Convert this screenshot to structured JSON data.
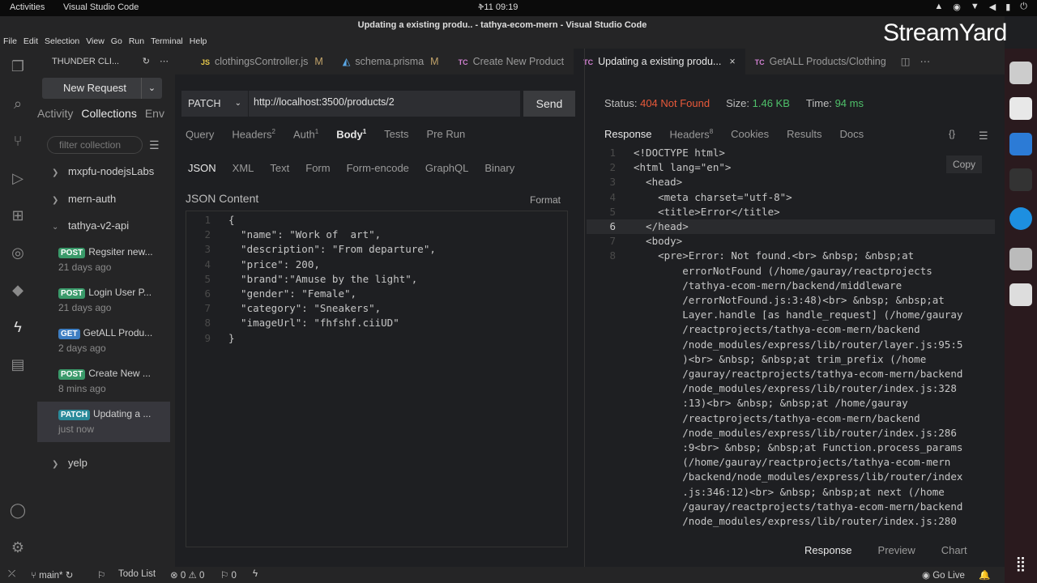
{
  "system": {
    "activities": "Activities",
    "app": "Visual Studio Code",
    "clock": "ቅ11 09:19"
  },
  "window": {
    "title": "Updating a existing produ.. - tathya-ecom-mern - Visual Studio Code"
  },
  "menu": [
    "File",
    "Edit",
    "Selection",
    "View",
    "Go",
    "Run",
    "Terminal",
    "Help"
  ],
  "watermark": "StreamYard",
  "sidebar": {
    "header": "THUNDER CLI...",
    "new_request": "New Request",
    "tabs": [
      "Activity",
      "Collections",
      "Env"
    ],
    "filter_placeholder": "filter collection",
    "folders": [
      {
        "name": "mxpfu-nodejsLabs",
        "expanded": false
      },
      {
        "name": "mern-auth",
        "expanded": false
      },
      {
        "name": "tathya-v2-api",
        "expanded": true
      },
      {
        "name": "yelp",
        "expanded": false
      }
    ],
    "requests": [
      {
        "method": "POST",
        "name": "Regsiter new...",
        "time": "21 days ago"
      },
      {
        "method": "POST",
        "name": "Login User P...",
        "time": "21 days ago"
      },
      {
        "method": "GET",
        "name": "GetALL Produ...",
        "time": "2 days ago"
      },
      {
        "method": "POST",
        "name": "Create New ...",
        "time": "8 mins ago"
      },
      {
        "method": "PATCH",
        "name": "Updating a ...",
        "time": "just now"
      }
    ]
  },
  "tabs": [
    {
      "icon": "JS",
      "label": "clothingsController.js",
      "mod": "M"
    },
    {
      "icon": "prisma",
      "label": "schema.prisma",
      "mod": "M"
    },
    {
      "icon": "TC",
      "label": "Create New Product",
      "mod": ""
    },
    {
      "icon": "TC",
      "label": "Updating a existing produ...",
      "mod": "",
      "close": "×"
    },
    {
      "icon": "TC",
      "label": "GetALL Products/Clothing",
      "mod": ""
    }
  ],
  "request": {
    "method": "PATCH",
    "url": "http://localhost:3500/products/2",
    "send": "Send",
    "tabs": [
      {
        "label": "Query",
        "count": ""
      },
      {
        "label": "Headers",
        "count": "2"
      },
      {
        "label": "Auth",
        "count": "1"
      },
      {
        "label": "Body",
        "count": "1"
      },
      {
        "label": "Tests",
        "count": ""
      },
      {
        "label": "Pre Run",
        "count": ""
      }
    ],
    "body_tabs": [
      "JSON",
      "XML",
      "Text",
      "Form",
      "Form-encode",
      "GraphQL",
      "Binary"
    ],
    "json_label": "JSON Content",
    "format": "Format",
    "body_lines": [
      "{",
      "  \"name\": \"Work of  art\",",
      "  \"description\": \"From departure\",",
      "  \"price\": 200,",
      "  \"brand\":\"Amuse by the light\",",
      "  \"gender\": \"Female\",",
      "  \"category\": \"Sneakers\",",
      "  \"imageUrl\": \"fhfshf.ciiUD\"",
      "}"
    ]
  },
  "response": {
    "status_label": "Status:",
    "status": "404 Not Found",
    "size_label": "Size:",
    "size": "1.46 KB",
    "time_label": "Time:",
    "time": "94 ms",
    "tabs": [
      {
        "label": "Response",
        "count": ""
      },
      {
        "label": "Headers",
        "count": "8"
      },
      {
        "label": "Cookies",
        "count": ""
      },
      {
        "label": "Results",
        "count": ""
      },
      {
        "label": "Docs",
        "count": ""
      }
    ],
    "braces": "{}",
    "copy": "Copy",
    "lines": [
      {
        "n": "1",
        "t": "<!DOCTYPE html>"
      },
      {
        "n": "2",
        "t": "<html lang=\"en\">"
      },
      {
        "n": "3",
        "t": "  <head>"
      },
      {
        "n": "4",
        "t": "    <meta charset=\"utf-8\">"
      },
      {
        "n": "5",
        "t": "    <title>Error</title>"
      },
      {
        "n": "6",
        "t": "  </head>"
      },
      {
        "n": "7",
        "t": "  <body>"
      },
      {
        "n": "8",
        "t": "    <pre>Error: Not found.<br> &nbsp; &nbsp;at"
      },
      {
        "n": "",
        "t": "        errorNotFound (/home/gauray/reactprojects"
      },
      {
        "n": "",
        "t": "        /tathya-ecom-mern/backend/middleware"
      },
      {
        "n": "",
        "t": "        /errorNotFound.js:3:48)<br> &nbsp; &nbsp;at"
      },
      {
        "n": "",
        "t": "        Layer.handle [as handle_request] (/home/gauray"
      },
      {
        "n": "",
        "t": "        /reactprojects/tathya-ecom-mern/backend"
      },
      {
        "n": "",
        "t": "        /node_modules/express/lib/router/layer.js:95:5"
      },
      {
        "n": "",
        "t": "        )<br> &nbsp; &nbsp;at trim_prefix (/home"
      },
      {
        "n": "",
        "t": "        /gauray/reactprojects/tathya-ecom-mern/backend"
      },
      {
        "n": "",
        "t": "        /node_modules/express/lib/router/index.js:328"
      },
      {
        "n": "",
        "t": "        :13)<br> &nbsp; &nbsp;at /home/gauray"
      },
      {
        "n": "",
        "t": "        /reactprojects/tathya-ecom-mern/backend"
      },
      {
        "n": "",
        "t": "        /node_modules/express/lib/router/index.js:286"
      },
      {
        "n": "",
        "t": "        :9<br> &nbsp; &nbsp;at Function.process_params"
      },
      {
        "n": "",
        "t": "        (/home/gauray/reactprojects/tathya-ecom-mern"
      },
      {
        "n": "",
        "t": "        /backend/node_modules/express/lib/router/index"
      },
      {
        "n": "",
        "t": "        .js:346:12)<br> &nbsp; &nbsp;at next (/home"
      },
      {
        "n": "",
        "t": "        /gauray/reactprojects/tathya-ecom-mern/backend"
      },
      {
        "n": "",
        "t": "        /node_modules/express/lib/router/index.js:280"
      }
    ],
    "bottom_tabs": [
      "Response",
      "Preview",
      "Chart"
    ]
  },
  "statusbar": {
    "branch": "main*",
    "todo": "Todo List",
    "errors": "0",
    "warnings": "0",
    "ports": "0",
    "golive": "Go Live"
  }
}
